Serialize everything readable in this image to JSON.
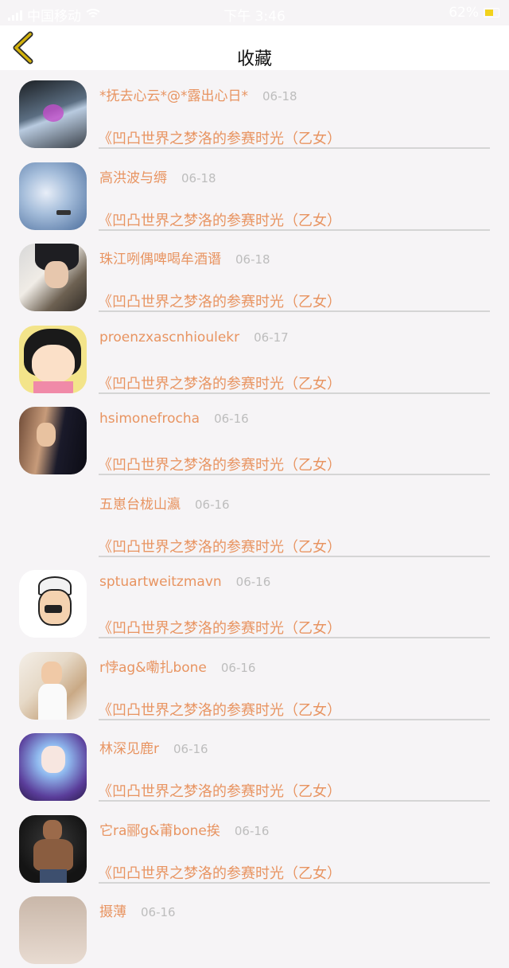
{
  "status_bar": {
    "carrier": "中国移动",
    "time": "下午 3:46",
    "battery": "62%"
  },
  "header": {
    "title": "收藏"
  },
  "colors": {
    "accent": "#e89461",
    "date": "#bdbdbd",
    "back_icon": "#d2b10c"
  },
  "favorites": [
    {
      "name": "*抚去心云*@*露出心日*",
      "date": "06-18",
      "work": "《凹凸世界之梦洛的参赛时光（乙女）"
    },
    {
      "name": "高洪波与缛",
      "date": "06-18",
      "work": "《凹凸世界之梦洛的参赛时光（乙女）"
    },
    {
      "name": "珠江咧偶啤喝牟酒谮",
      "date": "06-18",
      "work": "《凹凸世界之梦洛的参赛时光（乙女）"
    },
    {
      "name": "proenzxascnhioulekr",
      "date": "06-17",
      "work": "《凹凸世界之梦洛的参赛时光（乙女）"
    },
    {
      "name": "hsimonefrocha",
      "date": "06-16",
      "work": "《凹凸世界之梦洛的参赛时光（乙女）"
    },
    {
      "name": "五崽台栊山瀛",
      "date": "06-16",
      "work": "《凹凸世界之梦洛的参赛时光（乙女）"
    },
    {
      "name": "sptuartweitzmavn",
      "date": "06-16",
      "work": "《凹凸世界之梦洛的参赛时光（乙女）"
    },
    {
      "name": "r悖ag&嘞扎bone",
      "date": "06-16",
      "work": "《凹凸世界之梦洛的参赛时光（乙女）"
    },
    {
      "name": "林深见鹿r",
      "date": "06-16",
      "work": "《凹凸世界之梦洛的参赛时光（乙女）"
    },
    {
      "name": "它ra郦g&莆bone挨",
      "date": "06-16",
      "work": "《凹凸世界之梦洛的参赛时光（乙女）"
    },
    {
      "name": "摄薄",
      "date": "06-16",
      "work": ""
    }
  ]
}
